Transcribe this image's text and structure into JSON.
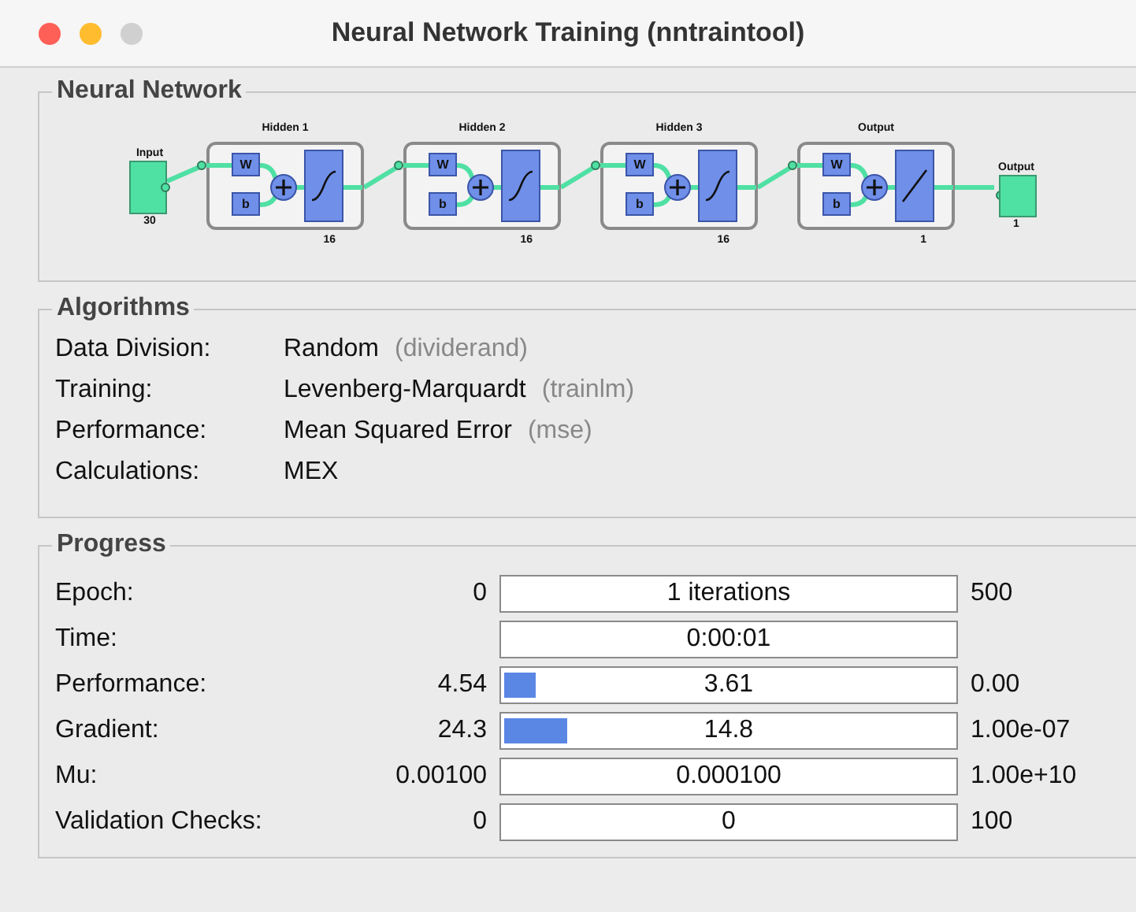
{
  "window": {
    "title": "Neural Network Training (nntraintool)",
    "controls": [
      {
        "kind": "close"
      },
      {
        "kind": "minimize"
      },
      {
        "kind": "zoom"
      }
    ]
  },
  "network": {
    "title": "Neural Network",
    "input": {
      "label": "Input",
      "size": "30"
    },
    "layers": [
      {
        "title": "Hidden 1",
        "weight": "W",
        "bias": "b",
        "kind": "sigmoid",
        "size": "16"
      },
      {
        "title": "Hidden 2",
        "weight": "W",
        "bias": "b",
        "kind": "sigmoid",
        "size": "16"
      },
      {
        "title": "Hidden 3",
        "weight": "W",
        "bias": "b",
        "kind": "sigmoid",
        "size": "16"
      },
      {
        "title": "Output",
        "weight": "W",
        "bias": "b",
        "kind": "linear",
        "size": "1"
      }
    ],
    "output": {
      "label": "Output",
      "size": "1"
    }
  },
  "algorithms": {
    "title": "Algorithms",
    "rows": [
      {
        "label": "Data Division:",
        "value": "Random",
        "hint": "(dividerand)"
      },
      {
        "label": "Training:",
        "value": "Levenberg-Marquardt",
        "hint": "(trainlm)"
      },
      {
        "label": "Performance:",
        "value": "Mean Squared Error",
        "hint": "(mse)"
      },
      {
        "label": "Calculations:",
        "value": "MEX"
      }
    ]
  },
  "progress": {
    "title": "Progress",
    "rows": [
      {
        "label": "Epoch:",
        "start": "0",
        "reading": "1 iterations",
        "end": "500"
      },
      {
        "label": "Time:",
        "reading": "0:00:01"
      },
      {
        "label": "Performance:",
        "start": "4.54",
        "level": 0.07,
        "reading": "3.61",
        "end": "0.00"
      },
      {
        "label": "Gradient:",
        "start": "24.3",
        "level": 0.14,
        "reading": "14.8",
        "end": "1.00e-07"
      },
      {
        "label": "Mu:",
        "start": "0.00100",
        "reading": "0.000100",
        "end": "1.00e+10"
      },
      {
        "label": "Validation Checks:",
        "start": "0",
        "reading": "0",
        "end": "100"
      }
    ]
  }
}
